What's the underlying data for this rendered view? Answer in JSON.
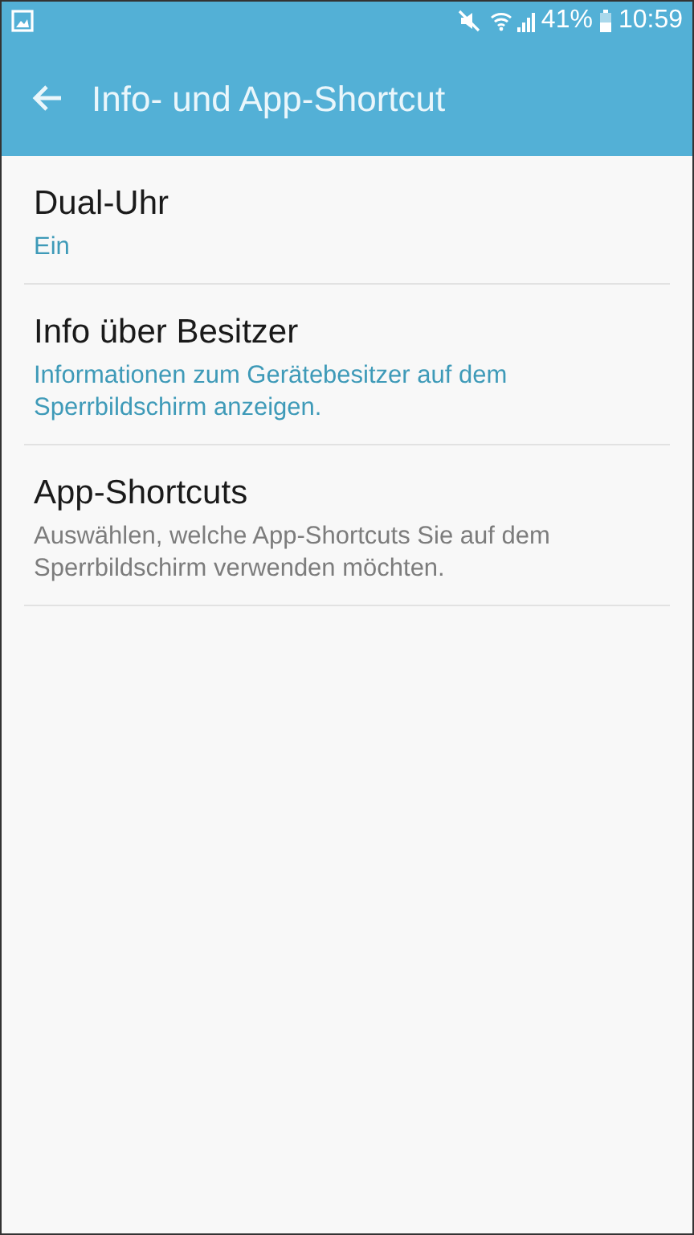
{
  "status_bar": {
    "battery": "41%",
    "time": "10:59"
  },
  "app_bar": {
    "title": "Info- und App-Shortcut"
  },
  "items": [
    {
      "title": "Dual-Uhr",
      "subtitle": "Ein",
      "kind": "status"
    },
    {
      "title": "Info über Besitzer",
      "subtitle": "Informationen zum Gerätebesitzer auf dem Sperrbildschirm anzeigen.",
      "kind": "status"
    },
    {
      "title": "App-Shortcuts",
      "subtitle": "Auswählen, welche App-Shortcuts Sie auf dem Sperrbildschirm verwenden möchten.",
      "kind": "hint"
    }
  ]
}
